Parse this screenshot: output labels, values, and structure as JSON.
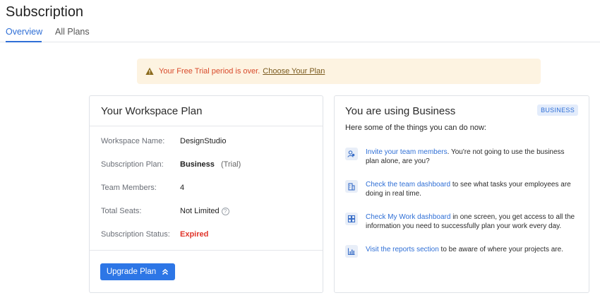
{
  "page": {
    "title": "Subscription"
  },
  "tabs": [
    {
      "label": "Overview",
      "active": true
    },
    {
      "label": "All Plans",
      "active": false
    }
  ],
  "alert": {
    "icon": "warning-triangle-icon",
    "message": "Your Free Trial period is over.",
    "link": "Choose Your Plan"
  },
  "workspace": {
    "title": "Your Workspace Plan",
    "rows": {
      "name": {
        "label": "Workspace Name:",
        "value": "DesignStudio"
      },
      "plan": {
        "label": "Subscription Plan:",
        "value": "Business",
        "note": "(Trial)"
      },
      "members": {
        "label": "Team Members:",
        "value": "4"
      },
      "seats": {
        "label": "Total Seats:",
        "value": "Not Limited",
        "help": "?"
      },
      "status": {
        "label": "Subscription Status:",
        "value": "Expired"
      }
    },
    "upgrade_label": "Upgrade Plan"
  },
  "business": {
    "title": "You are using Business",
    "badge": "BUSINESS",
    "intro": "Here some of the things you can do now:",
    "actions": [
      {
        "icon": "team-members-icon",
        "link": "Invite your team members",
        "text": ". You're not going to use the business plan alone, are you?"
      },
      {
        "icon": "dashboard-building-icon",
        "link": "Check the team dashboard",
        "text": " to see what tasks your employees are doing in real time."
      },
      {
        "icon": "grid-dashboard-icon",
        "link": "Check My Work dashboard",
        "text": " in one screen, you get access to all the information you need to successfully plan your work every day."
      },
      {
        "icon": "bar-chart-icon",
        "link": "Visit the reports section",
        "text": " to be aware of where your projects are."
      }
    ]
  },
  "colors": {
    "accent": "#2f6fd6",
    "button": "#2d76e6",
    "alert_bg": "#fdf3e1",
    "alert_text": "#d84a2b",
    "expired": "#e0342a"
  }
}
